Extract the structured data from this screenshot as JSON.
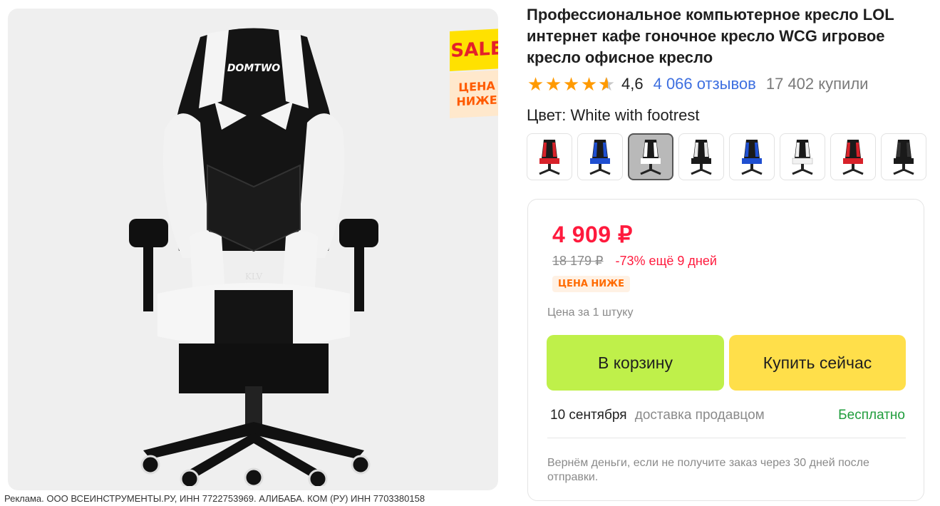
{
  "product": {
    "title": "Профессиональное компьютерное кресло LOL интернет кафе гоночное кресло WCG игровое кресло офисное кресло",
    "rating": {
      "stars": 4.6,
      "value": "4,6",
      "reviews": "4 066 отзывов",
      "bought": "17 402 купили"
    },
    "color": {
      "label": "Цвет: White with footrest"
    },
    "swatches": [
      {
        "name": "red-black",
        "accent": "#d8222a",
        "selected": false
      },
      {
        "name": "blue-black",
        "accent": "#1f4fd1",
        "selected": false
      },
      {
        "name": "white-black",
        "accent": "#ffffff",
        "selected": true
      },
      {
        "name": "black-white",
        "accent": "#222222",
        "selected": false
      },
      {
        "name": "blue-black-2",
        "accent": "#1f4fd1",
        "selected": false
      },
      {
        "name": "white-black-2",
        "accent": "#ffffff",
        "selected": false
      },
      {
        "name": "red-black-2",
        "accent": "#d8222a",
        "selected": false
      },
      {
        "name": "black",
        "accent": "#222222",
        "selected": false
      }
    ]
  },
  "image": {
    "sale_badge": {
      "top": "SALE",
      "bottom_line1": "ЦЕНА",
      "bottom_line2": "НИЖЕ"
    },
    "brand_logo_text": "DOMTWO",
    "seat_logo_text": "KLV"
  },
  "price": {
    "current": "4 909 ₽",
    "old": "18 179 ₽",
    "discount": "-73% ещё 9 дней",
    "badge": "ЦЕНА НИЖЕ",
    "per_unit": "Цена за 1 штуку",
    "add_to_cart": "В корзину",
    "buy_now": "Купить сейчас",
    "delivery_date": "10 сентября",
    "delivery_by": "доставка продавцом",
    "delivery_cost": "Бесплатно",
    "refund_note": "Вернём деньги, если не получите заказ через 30 дней после отправки."
  },
  "ad_note": "Реклама. ООО ВСЕИНСТРУМЕНТЫ.РУ, ИНН 7722753969. АЛИБАБА. КОМ (РУ) ИНН 7703380158",
  "colors": {
    "price_red": "#ff1a3d",
    "cart_green": "#bff04a",
    "buy_yellow": "#ffdf4a",
    "link_blue": "#3d6fe0",
    "star_orange": "#ff9a00",
    "free_green": "#1f9d3c"
  }
}
